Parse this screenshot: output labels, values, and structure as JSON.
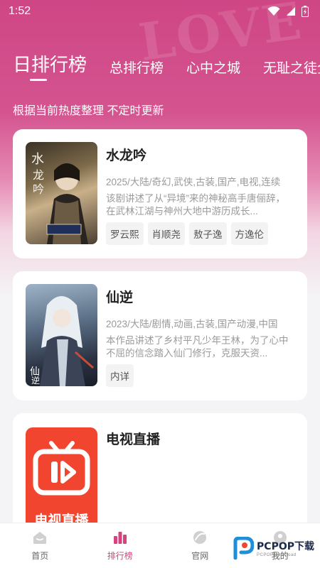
{
  "status_bar": {
    "time": "1:52"
  },
  "hero": {
    "watermark_text": "LOVE"
  },
  "tabs": [
    {
      "label": "日排行榜",
      "active": true
    },
    {
      "label": "总排行榜",
      "active": false
    },
    {
      "label": "心中之城",
      "active": false
    },
    {
      "label": "无耻之徒全",
      "active": false
    }
  ],
  "subtitle": "根据当前热度整理 不定时更新",
  "cards": [
    {
      "title": "水龙吟",
      "meta": "2025/大陆/奇幻,武侠,古装,国产,电视,连续",
      "description": "该剧讲述了从“异境”来的神秘高手唐俪辞，在武林江湖与神州大地中游历成长...",
      "cast": [
        "罗云熙",
        "肖顺尧",
        "敖子逸",
        "方逸伦"
      ],
      "poster_text": "水龙吟"
    },
    {
      "title": "仙逆",
      "meta": "2023/大陆/剧情,动画,古装,国产动漫,中国",
      "description": "本作品讲述了乡村平凡少年王林，为了心中不屈的信念踏入仙门修行，克服天资...",
      "cast": [
        "内详"
      ],
      "poster_text": "仙逆"
    },
    {
      "title": "电视直播",
      "meta": "",
      "description": "",
      "cast": [],
      "poster_text": "电视直播"
    }
  ],
  "bottom_nav": [
    {
      "label": "首页",
      "icon": "home-icon",
      "active": false
    },
    {
      "label": "排行榜",
      "icon": "ranking-icon",
      "active": true
    },
    {
      "label": "官网",
      "icon": "website-icon",
      "active": false
    },
    {
      "label": "我的",
      "icon": "profile-icon",
      "active": false
    }
  ],
  "watermark": {
    "brand": "PCPOP下载",
    "sub": "PCPOP.Download"
  },
  "colors": {
    "accent": "#d8427f",
    "hero_top": "#cf4685"
  }
}
